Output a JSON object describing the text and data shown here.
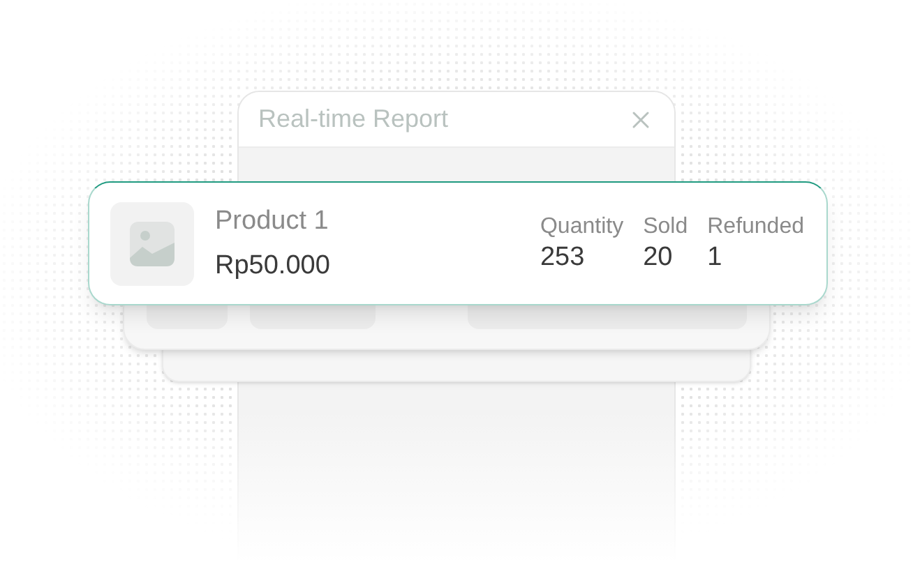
{
  "dialog": {
    "title": "Real-time Report"
  },
  "product": {
    "name": "Product 1",
    "price": "Rp50.000"
  },
  "stats": [
    {
      "label": "Quantity",
      "value": "253"
    },
    {
      "label": "Sold",
      "value": "20"
    },
    {
      "label": "Refunded",
      "value": "1"
    }
  ]
}
